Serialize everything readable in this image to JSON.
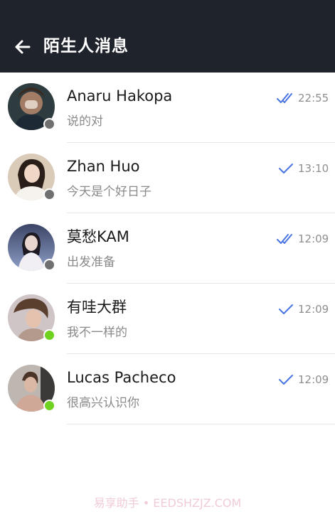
{
  "header": {
    "title": "陌生人消息",
    "background": "#1f232b",
    "back_icon": "arrow-left-icon"
  },
  "colors": {
    "check_blue": "#4a74e3",
    "status_online": "#6fd21e",
    "status_offline": "#707070"
  },
  "conversations": [
    {
      "name": "Anaru Hakopa",
      "message": "说的对",
      "time": "22:55",
      "status": "offline",
      "read_state": "double-check"
    },
    {
      "name": "Zhan Huo",
      "message": "今天是个好日子",
      "time": "13:10",
      "status": "offline",
      "read_state": "single-check"
    },
    {
      "name": "莫愁KAM",
      "message": "出发准备",
      "time": "12:09",
      "status": "offline",
      "read_state": "double-check"
    },
    {
      "name": "有哇大群",
      "message": "我不一样的",
      "time": "12:09",
      "status": "online",
      "read_state": "single-check"
    },
    {
      "name": "Lucas Pacheco",
      "message": "很高兴认识你",
      "time": "12:09",
      "status": "online",
      "read_state": "single-check"
    }
  ],
  "watermark": "易享助手 • EEDSHZJZ.COM"
}
